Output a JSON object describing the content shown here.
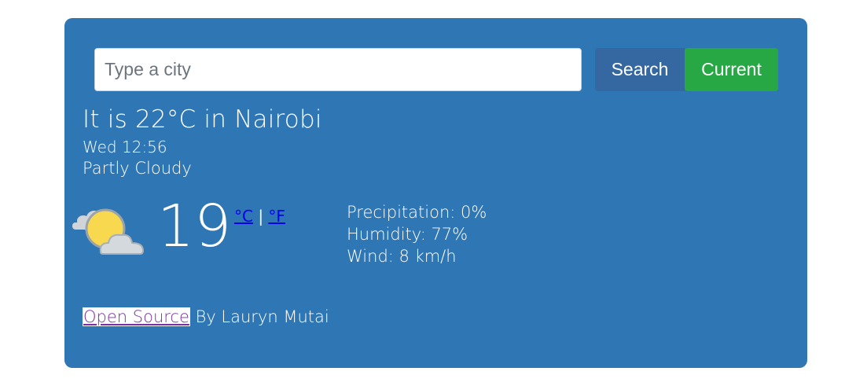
{
  "search": {
    "placeholder": "Type a city",
    "value": "",
    "search_label": "Search",
    "current_label": "Current"
  },
  "current": {
    "headline": "It is 22°C in Nairobi",
    "datetime": "Wed 12:56",
    "description": "Partly Cloudy",
    "icon": "partly-cloudy-icon",
    "temperature": "19",
    "unit_celsius": "°C",
    "unit_separator": " | ",
    "unit_fahrenheit": "°F"
  },
  "details": {
    "precipitation": "Precipitation: 0%",
    "humidity": "Humidity: 77%",
    "wind": "Wind: 8 km/h"
  },
  "footer": {
    "link_label": "Open Source",
    "byline": " By Lauryn Mutai"
  },
  "colors": {
    "card_background": "#2f76b5",
    "search_button": "#3567a0",
    "current_button": "#28a745",
    "link": "#0000ee"
  }
}
